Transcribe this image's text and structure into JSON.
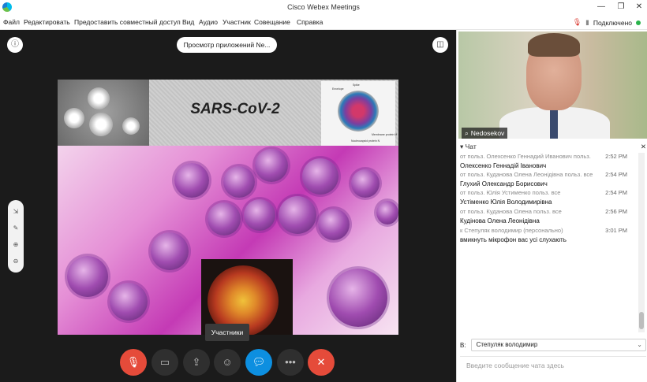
{
  "titlebar": {
    "title": "Cisco Webex Meetings",
    "minimize": "—",
    "restore": "❐",
    "close": "✕"
  },
  "menu": {
    "items": [
      "Файл",
      "Редактировать",
      "Предоставить совместный доступ",
      "Вид",
      "Аудио",
      "Участник",
      "Совещание",
      "Справка"
    ],
    "status_label": "Подключено"
  },
  "stage": {
    "info_icon": "ⓘ",
    "layout_icon": "◫",
    "app_view_label": "Просмотр приложений Ne...",
    "tooltip": "Участники"
  },
  "slide": {
    "title": "SARS-CoV-2",
    "diagram_labels": [
      "Spike",
      "Envelope",
      "Membrane protein M",
      "Nucleocapsid protein N"
    ]
  },
  "controls": {
    "mute_icon": "mic-off-icon",
    "video_icon": "video-off-icon",
    "share_icon": "share-icon",
    "participants_icon": "participants-icon",
    "chat_icon": "chat-icon",
    "more_icon": "more-icon",
    "end_icon": "end-call-icon"
  },
  "video": {
    "name": "Nedosekov"
  },
  "chat": {
    "header_label": "Чат",
    "collapse": "✕",
    "messages": [
      {
        "meta": "от польз. Олехсенко Геннадий Иванович польз.",
        "time": "2:52 PM"
      },
      {
        "text": "Олексенко Геннадій Іванович",
        "time": ""
      },
      {
        "meta": "от польз. Куданова Олена Леонідівна польз. все",
        "time": "2:54 PM"
      },
      {
        "text": "Глухий Олександр Борисович",
        "time": ""
      },
      {
        "meta": "от польз. Юлія Устименко польз. все",
        "time": "2:54 PM"
      },
      {
        "text": "Устіменко Юлія Володимирівна",
        "time": ""
      },
      {
        "meta": "от польз. Куданова Олена польз. все",
        "time": "2:56 PM"
      },
      {
        "text": "Кудінова Олена Леонідівна",
        "time": ""
      },
      {
        "meta": "к Степуляк володимир (персонально)",
        "time": "3:01 PM"
      },
      {
        "text": "вмикнуть мікрофон вас усі слухають",
        "time": ""
      }
    ],
    "to_label": "В:",
    "to_value": "Степуляк володимир",
    "input_placeholder": "Введите сообщение чата здесь"
  }
}
